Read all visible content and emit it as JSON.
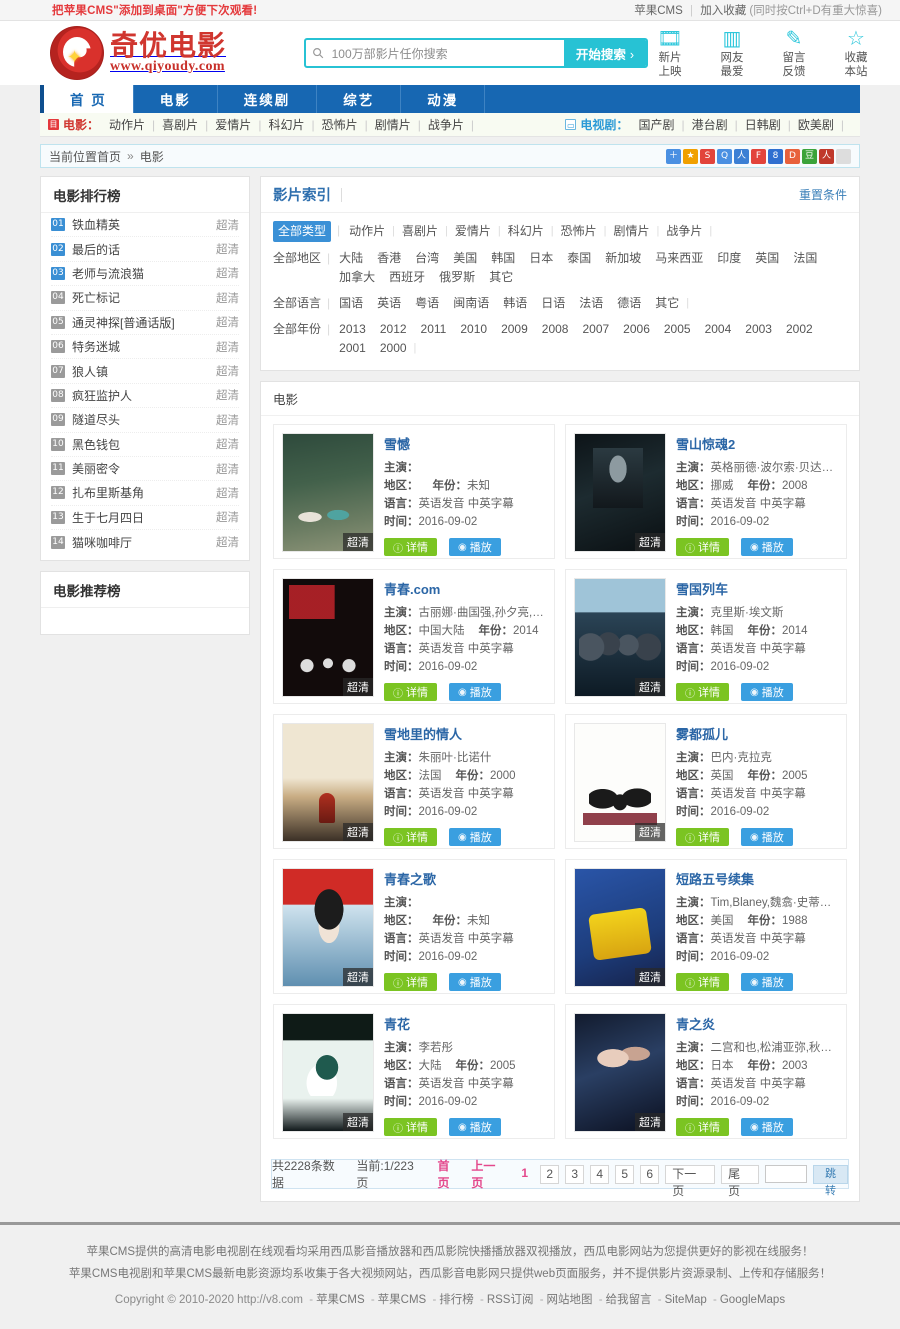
{
  "topbar": {
    "tip": "把苹果CMS\"添加到桌面\"方便下次观看!",
    "brand": "苹果CMS",
    "fav": "加入收藏",
    "fav_hint": "(同时按Ctrl+D有重大惊喜)"
  },
  "header": {
    "logo_cn": "奇优电影",
    "logo_en": "www.qiyoudy.com",
    "search_placeholder": "100万部影片任你搜索",
    "search_value": "100万部影片任你搜索",
    "search_button": "开始搜索",
    "search_button_arrow": "›",
    "icons": [
      {
        "name": "new-release-icon",
        "glyph": "🎞",
        "l1": "新片",
        "l2": "上映"
      },
      {
        "name": "popular-icon",
        "glyph": "▥",
        "l1": "网友",
        "l2": "最爱"
      },
      {
        "name": "feedback-icon",
        "glyph": "✎",
        "l1": "留言",
        "l2": "反馈"
      },
      {
        "name": "favorite-icon",
        "glyph": "☆",
        "l1": "收藏",
        "l2": "本站"
      }
    ]
  },
  "nav": [
    {
      "label": "首 页",
      "active": true
    },
    {
      "label": "电影",
      "active": false
    },
    {
      "label": "连续剧",
      "active": false
    },
    {
      "label": "综艺",
      "active": false
    },
    {
      "label": "动漫",
      "active": false
    }
  ],
  "subnav": {
    "movie_label": "电影：",
    "movie_items": [
      "动作片",
      "喜剧片",
      "爱情片",
      "科幻片",
      "恐怖片",
      "剧情片",
      "战争片"
    ],
    "tv_label": "电视剧：",
    "tv_items": [
      "国产剧",
      "港台剧",
      "日韩剧",
      "欧美剧"
    ]
  },
  "breadcrumb": {
    "prefix": "当前位置",
    "home": "首页",
    "arrow": "»",
    "current": "电影",
    "share_icons": [
      "＋",
      "★",
      "S",
      "Q",
      "人",
      "F",
      "8",
      "D",
      "豆",
      "人"
    ]
  },
  "sidebar": {
    "rank_title": "电影排行榜",
    "rank_items": [
      {
        "no": "01",
        "name": "铁血精英",
        "tag": "超清",
        "hot": true
      },
      {
        "no": "02",
        "name": "最后的话",
        "tag": "超清",
        "hot": true
      },
      {
        "no": "03",
        "name": "老师与流浪猫",
        "tag": "超清",
        "hot": true
      },
      {
        "no": "04",
        "name": "死亡标记",
        "tag": "超清",
        "hot": false
      },
      {
        "no": "05",
        "name": "通灵神探[普通话版]",
        "tag": "超清",
        "hot": false
      },
      {
        "no": "06",
        "name": "特务迷城",
        "tag": "超清",
        "hot": false
      },
      {
        "no": "07",
        "name": "狼人镇",
        "tag": "超清",
        "hot": false
      },
      {
        "no": "08",
        "name": "疯狂监护人",
        "tag": "超清",
        "hot": false
      },
      {
        "no": "09",
        "name": "隧道尽头",
        "tag": "超清",
        "hot": false
      },
      {
        "no": "10",
        "name": "黑色钱包",
        "tag": "超清",
        "hot": false
      },
      {
        "no": "11",
        "name": "美丽密令",
        "tag": "超清",
        "hot": false
      },
      {
        "no": "12",
        "name": "扎布里斯基角",
        "tag": "超清",
        "hot": false
      },
      {
        "no": "13",
        "name": "生于七月四日",
        "tag": "超清",
        "hot": false
      },
      {
        "no": "14",
        "name": "猫咪咖啡厅",
        "tag": "超清",
        "hot": false
      }
    ],
    "recommend_title": "电影推荐榜"
  },
  "filter": {
    "title": "影片索引",
    "reset": "重置条件",
    "rows": [
      {
        "key": "全部类型",
        "selected": true,
        "values": [
          "动作片",
          "喜剧片",
          "爱情片",
          "科幻片",
          "恐怖片",
          "剧情片",
          "战争片"
        ]
      },
      {
        "key": "全部地区",
        "selected": false,
        "values": [
          "大陆",
          "香港",
          "台湾",
          "美国",
          "韩国",
          "日本",
          "泰国",
          "新加坡",
          "马来西亚",
          "印度",
          "英国",
          "法国",
          "加拿大",
          "西班牙",
          "俄罗斯",
          "其它"
        ]
      },
      {
        "key": "全部语言",
        "selected": false,
        "values": [
          "国语",
          "英语",
          "粤语",
          "闽南语",
          "韩语",
          "日语",
          "法语",
          "德语",
          "其它"
        ]
      },
      {
        "key": "全部年份",
        "selected": false,
        "values": [
          "2013",
          "2012",
          "2011",
          "2010",
          "2009",
          "2008",
          "2007",
          "2006",
          "2005",
          "2004",
          "2003",
          "2002",
          "2001",
          "2000"
        ]
      }
    ]
  },
  "list": {
    "section_title": "电影",
    "labels": {
      "actor": "主演：",
      "area": "地区：",
      "year": "年份：",
      "language": "语言：",
      "time": "时间：",
      "detail": "详情",
      "play": "播放",
      "hd": "超清"
    },
    "items": [
      {
        "title": "雪憾",
        "actor": "",
        "area": "",
        "year": "未知",
        "language": "英语发音 中英字幕",
        "time": "2016-09-02",
        "art": "art-xuehuai"
      },
      {
        "title": "雪山惊魂2",
        "actor": "英格丽德·波尔索·贝达尔,Ma...",
        "area": "挪威",
        "year": "2008",
        "language": "英语发音 中英字幕",
        "time": "2016-09-02",
        "art": "art-xueshan"
      },
      {
        "title": "青春.com",
        "actor": "古丽娜·曲国强,孙夕亮,严萌,",
        "area": "中国大陆",
        "year": "2014",
        "language": "英语发音 中英字幕",
        "time": "2016-09-02",
        "art": "art-qingchun"
      },
      {
        "title": "雪国列车",
        "actor": "克里斯·埃文斯",
        "area": "韩国",
        "year": "2014",
        "language": "英语发音 中英字幕",
        "time": "2016-09-02",
        "art": "art-xueguo"
      },
      {
        "title": "雪地里的情人",
        "actor": "朱丽叶·比诺什",
        "area": "法国",
        "year": "2000",
        "language": "英语发音 中英字幕",
        "time": "2016-09-02",
        "art": "art-xuedi"
      },
      {
        "title": "雾都孤儿",
        "actor": "巴内·克拉克",
        "area": "英国",
        "year": "2005",
        "language": "英语发音 中英字幕",
        "time": "2016-09-02",
        "art": "art-wudu"
      },
      {
        "title": "青春之歌",
        "actor": "",
        "area": "",
        "year": "未知",
        "language": "英语发音 中英字幕",
        "time": "2016-09-02",
        "art": "art-qingge"
      },
      {
        "title": "短路五号续集",
        "actor": "Tim,Blaney,魏翕·史蒂芬斯...",
        "area": "美国",
        "year": "1988",
        "language": "英语发音 中英字幕",
        "time": "2016-09-02",
        "art": "art-duanpang"
      },
      {
        "title": "青花",
        "actor": "李若彤",
        "area": "大陆",
        "year": "2005",
        "language": "英语发音 中英字幕",
        "time": "2016-09-02",
        "art": "art-qinghua"
      },
      {
        "title": "青之炎",
        "actor": "二宫和也,松浦亚弥,秋吉久...",
        "area": "日本",
        "year": "2003",
        "language": "英语发音 中英字幕",
        "time": "2016-09-02",
        "art": "art-qingzhiyan"
      }
    ]
  },
  "pager": {
    "total_text": "共2228条数据",
    "current_text": "当前:1/223页",
    "first": "首页",
    "prev": "上一页",
    "pages": [
      "1",
      "2",
      "3",
      "4",
      "5",
      "6"
    ],
    "current_page": "1",
    "next": "下一页",
    "last": "尾页",
    "jump_value": "",
    "go": "跳 转"
  },
  "footer": {
    "line1": "苹果CMS提供的高清电影电视剧在线观看均采用西瓜影音播放器和西瓜影院快播播放器双视播放，西瓜电影网站为您提供更好的影视在线服务！",
    "line2": "苹果CMS电视剧和苹果CMS最新电影资源均系收集于各大视频网站，西瓜影音电影网只提供web页面服务，并不提供影片资源录制、上传和存储服务！",
    "copyright": "Copyright © 2010-2020 http://v8.com",
    "links": [
      "苹果CMS",
      "苹果CMS",
      "排行榜",
      "RSS订阅",
      "网站地图",
      "给我留言",
      "SiteMap",
      "GoogleMaps"
    ]
  },
  "colors": {
    "brand_blue": "#1767b2",
    "cyan": "#27c2d4",
    "red": "#d0362f",
    "green_btn": "#7bc422",
    "blue_btn": "#3a9fe0"
  }
}
